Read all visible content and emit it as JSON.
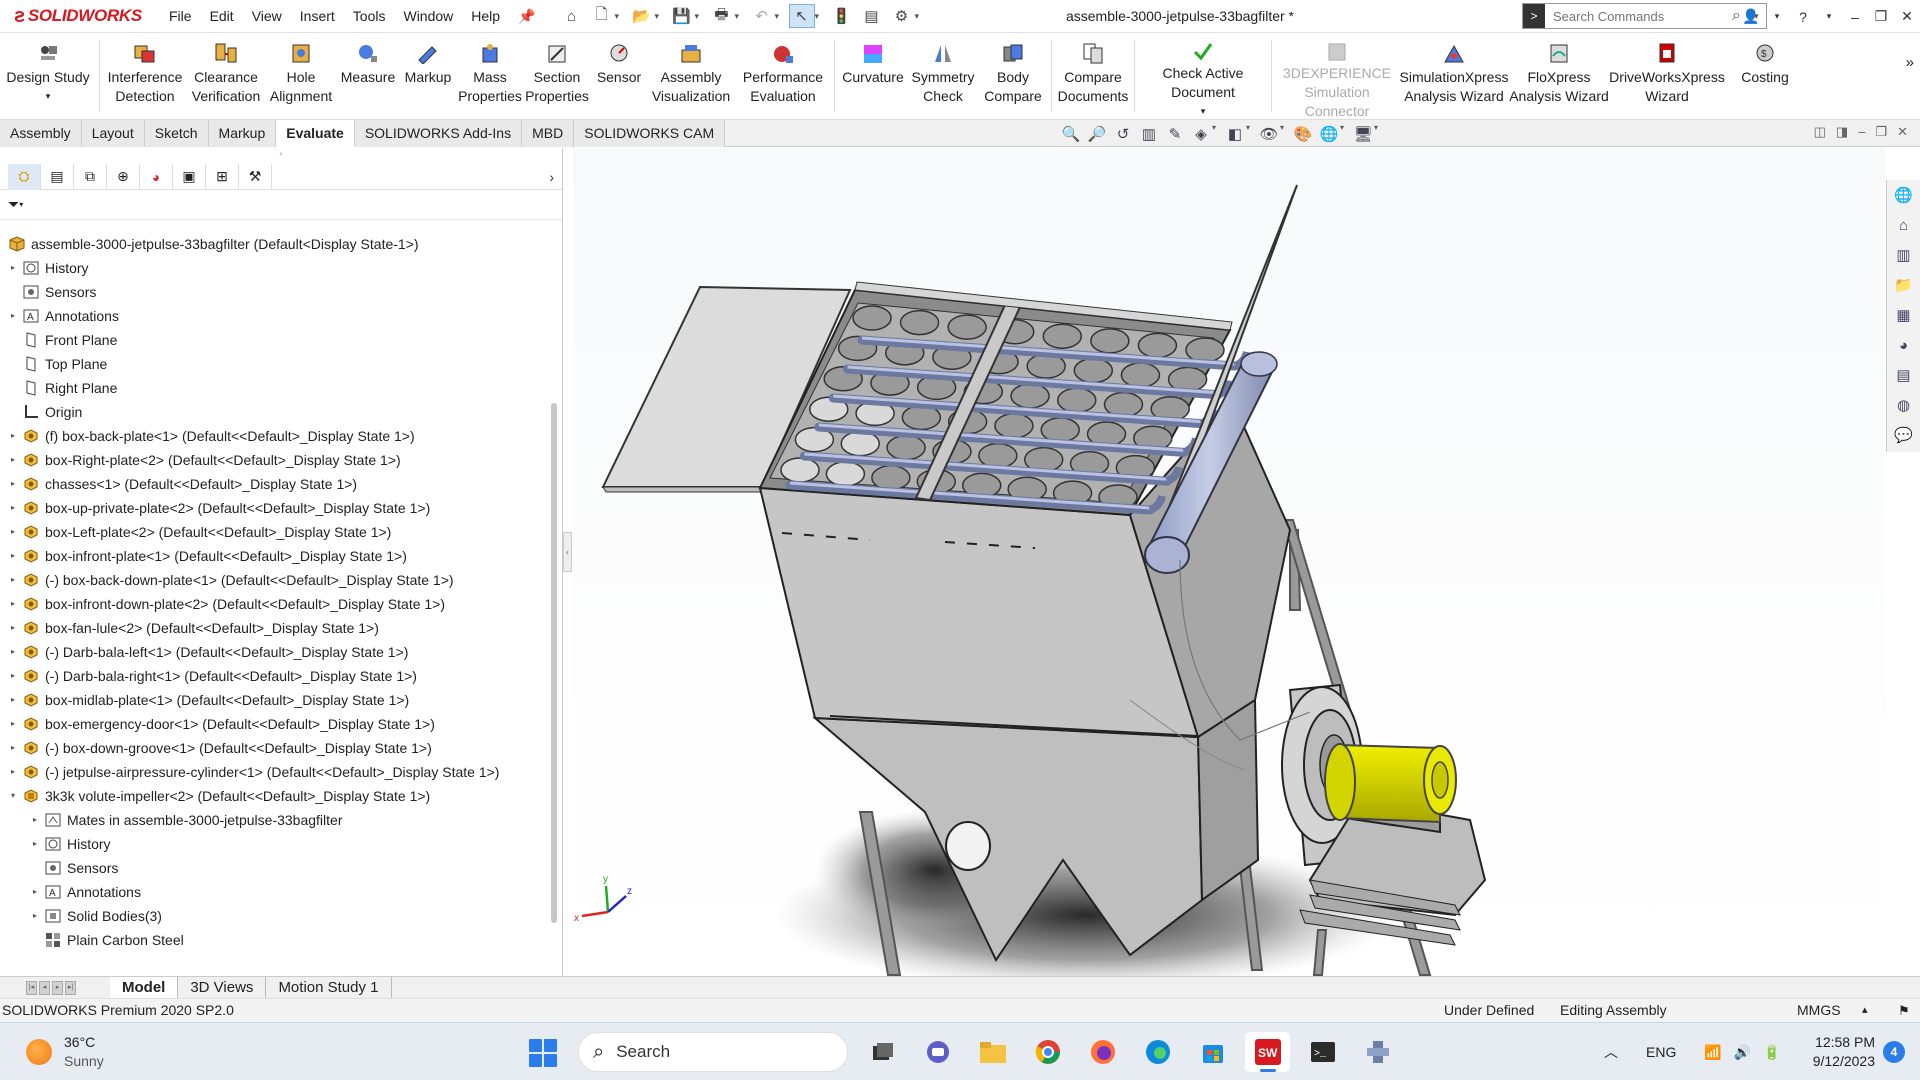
{
  "app": {
    "brand": "SOLIDWORKS",
    "document_title": "assemble-3000-jetpulse-33bagfilter *"
  },
  "menu": [
    "File",
    "Edit",
    "View",
    "Insert",
    "Tools",
    "Window",
    "Help"
  ],
  "command_search": {
    "placeholder": "Search Commands"
  },
  "command_manager": [
    {
      "label1": "Design Study",
      "label2": "",
      "icon": "design-study-icon"
    },
    {
      "label1": "Interference",
      "label2": "Detection",
      "icon": "interference-detection-icon"
    },
    {
      "label1": "Clearance",
      "label2": "Verification",
      "icon": "clearance-verification-icon"
    },
    {
      "label1": "Hole",
      "label2": "Alignment",
      "icon": "hole-alignment-icon"
    },
    {
      "label1": "Measure",
      "label2": "",
      "icon": "measure-icon"
    },
    {
      "label1": "Markup",
      "label2": "",
      "icon": "markup-icon"
    },
    {
      "label1": "Mass",
      "label2": "Properties",
      "icon": "mass-properties-icon"
    },
    {
      "label1": "Section",
      "label2": "Properties",
      "icon": "section-properties-icon"
    },
    {
      "label1": "Sensor",
      "label2": "",
      "icon": "sensor-icon"
    },
    {
      "label1": "Assembly",
      "label2": "Visualization",
      "icon": "assembly-visualization-icon"
    },
    {
      "label1": "Performance",
      "label2": "Evaluation",
      "icon": "performance-evaluation-icon"
    },
    {
      "label1": "Curvature",
      "label2": "",
      "icon": "curvature-icon"
    },
    {
      "label1": "Symmetry",
      "label2": "Check",
      "icon": "symmetry-check-icon"
    },
    {
      "label1": "Body",
      "label2": "Compare",
      "icon": "body-compare-icon"
    },
    {
      "label1": "Compare",
      "label2": "Documents",
      "icon": "compare-documents-icon"
    },
    {
      "label1": "Check Active Document",
      "label2": "",
      "icon": "check-active-document-icon"
    },
    {
      "label1": "3DEXPERIENCE",
      "label2": "Simulation Connector",
      "icon": "3dexperience-icon"
    },
    {
      "label1": "SimulationXpress",
      "label2": "Analysis Wizard",
      "icon": "simulationxpress-icon"
    },
    {
      "label1": "FloXpress",
      "label2": "Analysis Wizard",
      "icon": "floxpress-icon"
    },
    {
      "label1": "DriveWorksXpress",
      "label2": "Wizard",
      "icon": "driveworksxpress-icon"
    },
    {
      "label1": "Costing",
      "label2": "",
      "icon": "costing-icon"
    }
  ],
  "tabs": [
    "Assembly",
    "Layout",
    "Sketch",
    "Markup",
    "Evaluate",
    "SOLIDWORKS Add-Ins",
    "MBD",
    "SOLIDWORKS CAM"
  ],
  "active_tab": "Evaluate",
  "tree": {
    "root": "assemble-3000-jetpulse-33bagfilter  (Default<Display State-1>)",
    "items": [
      {
        "label": "History",
        "expander": true,
        "level": 1,
        "icon": "history-icon"
      },
      {
        "label": "Sensors",
        "expander": false,
        "level": 1,
        "icon": "sensors-icon"
      },
      {
        "label": "Annotations",
        "expander": true,
        "level": 1,
        "icon": "annotations-icon"
      },
      {
        "label": "Front Plane",
        "expander": false,
        "level": 1,
        "icon": "plane-icon"
      },
      {
        "label": "Top Plane",
        "expander": false,
        "level": 1,
        "icon": "plane-icon"
      },
      {
        "label": "Right Plane",
        "expander": false,
        "level": 1,
        "icon": "plane-icon"
      },
      {
        "label": "Origin",
        "expander": false,
        "level": 1,
        "icon": "origin-icon"
      },
      {
        "label": "(f) box-back-plate<1> (Default<<Default>_Display State 1>)",
        "expander": true,
        "level": 1,
        "icon": "part-icon"
      },
      {
        "label": "box-Right-plate<2> (Default<<Default>_Display State 1>)",
        "expander": true,
        "level": 1,
        "icon": "part-icon"
      },
      {
        "label": "chasses<1> (Default<<Default>_Display State 1>)",
        "expander": true,
        "level": 1,
        "icon": "part-icon"
      },
      {
        "label": "box-up-private-plate<2> (Default<<Default>_Display State 1>)",
        "expander": true,
        "level": 1,
        "icon": "part-icon"
      },
      {
        "label": "box-Left-plate<2> (Default<<Default>_Display State 1>)",
        "expander": true,
        "level": 1,
        "icon": "part-icon"
      },
      {
        "label": "box-infront-plate<1> (Default<<Default>_Display State 1>)",
        "expander": true,
        "level": 1,
        "icon": "part-icon"
      },
      {
        "label": "(-) box-back-down-plate<1> (Default<<Default>_Display State 1>)",
        "expander": true,
        "level": 1,
        "icon": "part-icon"
      },
      {
        "label": "box-infront-down-plate<2> (Default<<Default>_Display State 1>)",
        "expander": true,
        "level": 1,
        "icon": "part-icon"
      },
      {
        "label": "box-fan-lule<2> (Default<<Default>_Display State 1>)",
        "expander": true,
        "level": 1,
        "icon": "part-icon"
      },
      {
        "label": "(-) Darb-bala-left<1> (Default<<Default>_Display State 1>)",
        "expander": true,
        "level": 1,
        "icon": "part-icon"
      },
      {
        "label": "(-) Darb-bala-right<1> (Default<<Default>_Display State 1>)",
        "expander": true,
        "level": 1,
        "icon": "part-icon"
      },
      {
        "label": "box-midlab-plate<1> (Default<<Default>_Display State 1>)",
        "expander": true,
        "level": 1,
        "icon": "part-icon"
      },
      {
        "label": "box-emergency-door<1> (Default<<Default>_Display State 1>)",
        "expander": true,
        "level": 1,
        "icon": "part-icon"
      },
      {
        "label": "(-) box-down-groove<1> (Default<<Default>_Display State 1>)",
        "expander": true,
        "level": 1,
        "icon": "part-icon"
      },
      {
        "label": "(-) jetpulse-airpressure-cylinder<1> (Default<<Default>_Display State 1>)",
        "expander": true,
        "level": 1,
        "icon": "part-icon"
      },
      {
        "label": "3k3k volute-impeller<2> (Default<<Default>_Display State 1>)",
        "expander": "open",
        "level": 1,
        "icon": "subassembly-icon"
      },
      {
        "label": "Mates in assemble-3000-jetpulse-33bagfilter",
        "expander": true,
        "level": 2,
        "icon": "mates-icon"
      },
      {
        "label": "History",
        "expander": true,
        "level": 2,
        "icon": "history-icon"
      },
      {
        "label": "Sensors",
        "expander": false,
        "level": 2,
        "icon": "sensors-icon"
      },
      {
        "label": "Annotations",
        "expander": true,
        "level": 2,
        "icon": "annotations-icon"
      },
      {
        "label": "Solid Bodies(3)",
        "expander": true,
        "level": 2,
        "icon": "solid-bodies-icon"
      },
      {
        "label": "Plain Carbon Steel",
        "expander": false,
        "level": 2,
        "icon": "material-icon"
      }
    ]
  },
  "bottom_tabs": [
    "Model",
    "3D Views",
    "Motion Study 1"
  ],
  "active_bottom_tab": "Model",
  "status": {
    "product": "SOLIDWORKS Premium 2020 SP2.0",
    "definition": "Under Defined",
    "mode": "Editing Assembly",
    "units": "MMGS"
  },
  "taskbar": {
    "weather_temp": "36°C",
    "weather_cond": "Sunny",
    "search_label": "Search",
    "lang": "ENG",
    "time": "12:58 PM",
    "date": "9/12/2023",
    "notifications": "4"
  },
  "colors": {
    "brand_red": "#d71920",
    "accent": "#2b7de9",
    "motor": "#e0e000",
    "metal": "#b7b7b7"
  }
}
